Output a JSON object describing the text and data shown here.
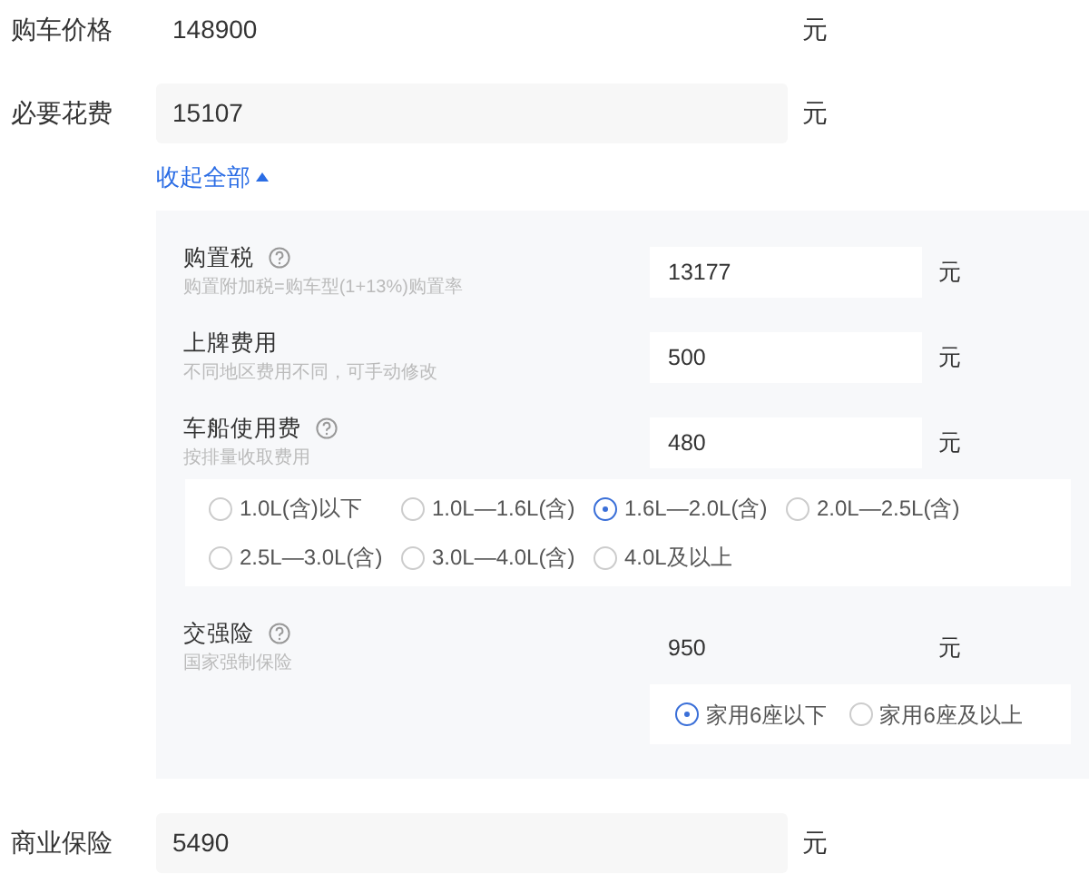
{
  "top_fields": [
    {
      "label": "购车价格",
      "value": "148900",
      "unit": "元"
    },
    {
      "label": "必要花费",
      "value": "15107",
      "unit": "元"
    }
  ],
  "toggle": {
    "label": "收起全部",
    "expanded": true
  },
  "panel": [
    {
      "label": "购置税",
      "help": true,
      "hint": "购置附加税=购车型(1+13%)购置率",
      "value": "13177",
      "unit": "元"
    },
    {
      "label": "上牌费用",
      "help": false,
      "hint": "不同地区费用不同，可手动修改",
      "value": "500",
      "unit": "元"
    },
    {
      "label": "车船使用费",
      "help": true,
      "hint": "按排量收取费用",
      "value": "480",
      "unit": "元",
      "options": [
        {
          "label": "1.0L(含)以下",
          "selected": false
        },
        {
          "label": "1.0L—1.6L(含)",
          "selected": false
        },
        {
          "label": "1.6L—2.0L(含)",
          "selected": true
        },
        {
          "label": "2.0L—2.5L(含)",
          "selected": false
        },
        {
          "label": "2.5L—3.0L(含)",
          "selected": false
        },
        {
          "label": "3.0L—4.0L(含)",
          "selected": false
        },
        {
          "label": "4.0L及以上",
          "selected": false
        }
      ]
    },
    {
      "label": "交强险",
      "help": true,
      "hint": "国家强制保险",
      "value": "950",
      "unit": "元",
      "options": [
        {
          "label": "家用6座以下",
          "selected": true
        },
        {
          "label": "家用6座及以上",
          "selected": false
        }
      ]
    }
  ],
  "bottom_fields": [
    {
      "label": "商业保险",
      "value": "5490",
      "unit": "元"
    }
  ]
}
